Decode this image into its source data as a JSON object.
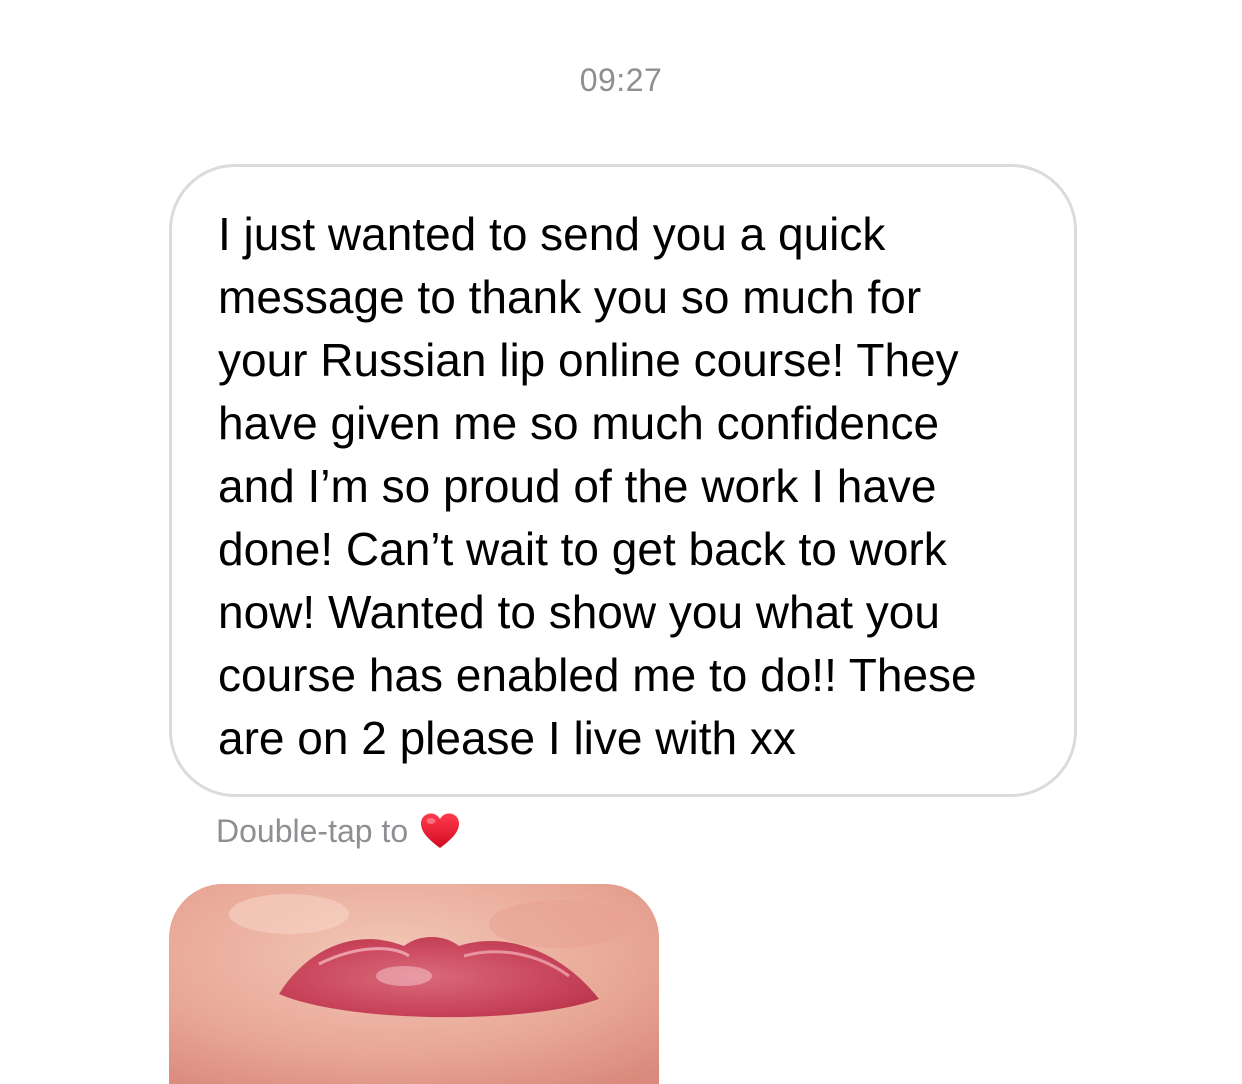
{
  "thread": {
    "timestamp": "09:27"
  },
  "message": {
    "lines": [
      "I just wanted to send you a quick",
      "message to thank you so much for",
      "your Russian lip online course! They",
      "have given me so much confidence",
      "and I’m so proud of the work I have",
      "done! Can’t wait to get back to work",
      "now! Wanted to show you what you",
      "course has enabled me to do!! These",
      "are on 2 please I live with xx"
    ],
    "hint": "Double-tap to",
    "hint_icon": "heart-icon",
    "bubble_border_color": "#dbdbdb",
    "heart_color": "#e0142b"
  },
  "attachment": {
    "type": "photo",
    "subject": "lips"
  }
}
